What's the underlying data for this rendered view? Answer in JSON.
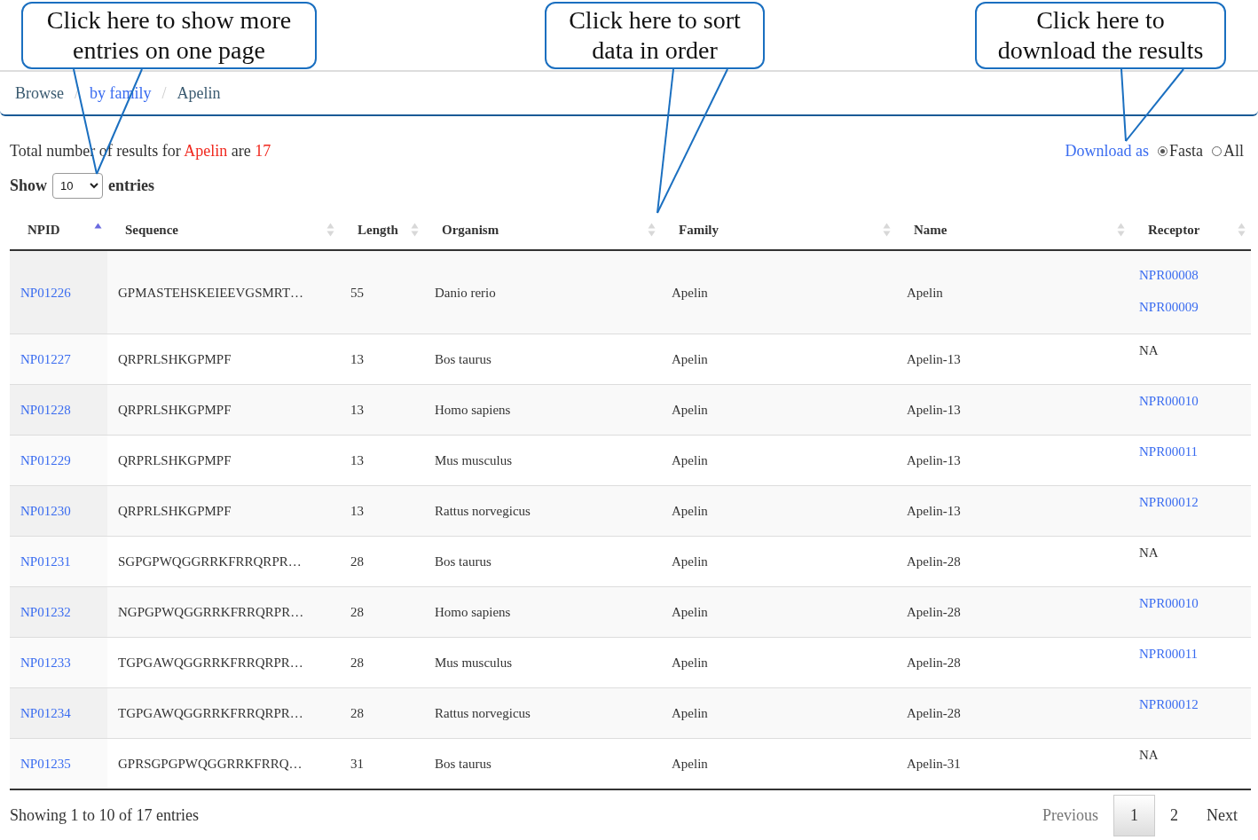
{
  "callouts": [
    {
      "text": "Click here to show more entries on one page"
    },
    {
      "text": "Click here to sort data in order"
    },
    {
      "text": "Click here to download the results"
    }
  ],
  "breadcrumb": [
    {
      "label": "Browse",
      "kind": "plain"
    },
    {
      "label": "by family",
      "kind": "link"
    },
    {
      "label": "Apelin",
      "kind": "plain"
    }
  ],
  "breadcrumb_separator": "/",
  "summary": {
    "prefix": "Total number of results for",
    "query": "Apelin",
    "middle": "are",
    "count": "17"
  },
  "download": {
    "label": "Download as",
    "options": [
      {
        "label": "Fasta",
        "selected": true
      },
      {
        "label": "All",
        "selected": false
      }
    ]
  },
  "length_menu": {
    "before": "Show",
    "value": "10",
    "after": "entries"
  },
  "table": {
    "columns": [
      {
        "label": "NPID",
        "sorted": true
      },
      {
        "label": "Sequence",
        "sorted": false
      },
      {
        "label": "Length",
        "sorted": false
      },
      {
        "label": "Organism",
        "sorted": false
      },
      {
        "label": "Family",
        "sorted": false
      },
      {
        "label": "Name",
        "sorted": false
      },
      {
        "label": "Receptor",
        "sorted": false
      }
    ],
    "rows": [
      {
        "npid": "NP01226",
        "sequence": "GPMASTEHSKEIEEVGSMRT…",
        "length": "55",
        "organism": "Danio rerio",
        "family": "Apelin",
        "name": "Apelin",
        "receptor": [
          {
            "text": "NPR00008",
            "kind": "link"
          },
          {
            "text": "NPR00009",
            "kind": "link"
          }
        ]
      },
      {
        "npid": "NP01227",
        "sequence": "QRPRLSHKGPMPF",
        "length": "13",
        "organism": "Bos taurus",
        "family": "Apelin",
        "name": "Apelin-13",
        "receptor": [
          {
            "text": "NA",
            "kind": "plain"
          }
        ]
      },
      {
        "npid": "NP01228",
        "sequence": "QRPRLSHKGPMPF",
        "length": "13",
        "organism": "Homo sapiens",
        "family": "Apelin",
        "name": "Apelin-13",
        "receptor": [
          {
            "text": "NPR00010",
            "kind": "link"
          }
        ]
      },
      {
        "npid": "NP01229",
        "sequence": "QRPRLSHKGPMPF",
        "length": "13",
        "organism": "Mus musculus",
        "family": "Apelin",
        "name": "Apelin-13",
        "receptor": [
          {
            "text": "NPR00011",
            "kind": "link"
          }
        ]
      },
      {
        "npid": "NP01230",
        "sequence": "QRPRLSHKGPMPF",
        "length": "13",
        "organism": "Rattus norvegicus",
        "family": "Apelin",
        "name": "Apelin-13",
        "receptor": [
          {
            "text": "NPR00012",
            "kind": "link"
          }
        ]
      },
      {
        "npid": "NP01231",
        "sequence": "SGPGPWQGGRRKFRRQRPR…",
        "length": "28",
        "organism": "Bos taurus",
        "family": "Apelin",
        "name": "Apelin-28",
        "receptor": [
          {
            "text": "NA",
            "kind": "plain"
          }
        ]
      },
      {
        "npid": "NP01232",
        "sequence": "NGPGPWQGGRRKFRRQRPR…",
        "length": "28",
        "organism": "Homo sapiens",
        "family": "Apelin",
        "name": "Apelin-28",
        "receptor": [
          {
            "text": "NPR00010",
            "kind": "link"
          }
        ]
      },
      {
        "npid": "NP01233",
        "sequence": "TGPGAWQGGRRKFRRQRPR…",
        "length": "28",
        "organism": "Mus musculus",
        "family": "Apelin",
        "name": "Apelin-28",
        "receptor": [
          {
            "text": "NPR00011",
            "kind": "link"
          }
        ]
      },
      {
        "npid": "NP01234",
        "sequence": "TGPGAWQGGRRKFRRQRPR…",
        "length": "28",
        "organism": "Rattus norvegicus",
        "family": "Apelin",
        "name": "Apelin-28",
        "receptor": [
          {
            "text": "NPR00012",
            "kind": "link"
          }
        ]
      },
      {
        "npid": "NP01235",
        "sequence": "GPRSGPGPWQGGRRKFRRQ…",
        "length": "31",
        "organism": "Bos taurus",
        "family": "Apelin",
        "name": "Apelin-31",
        "receptor": [
          {
            "text": "NA",
            "kind": "plain"
          }
        ]
      }
    ]
  },
  "info": "Showing 1 to 10 of 17 entries",
  "pagination": {
    "previous": "Previous",
    "pages": [
      {
        "label": "1",
        "selected": true
      },
      {
        "label": "2",
        "selected": false
      }
    ],
    "next": "Next"
  }
}
